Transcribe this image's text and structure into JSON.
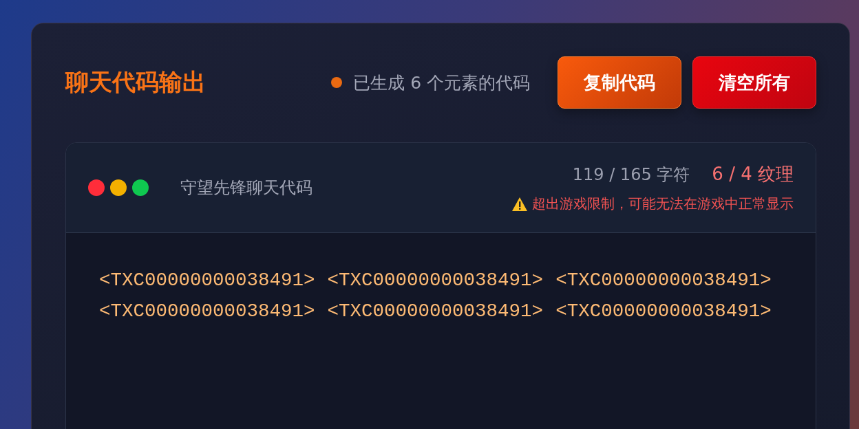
{
  "header": {
    "title": "聊天代码输出",
    "status": "已生成 6 个元素的代码",
    "buttons": [
      {
        "label": "复制代码",
        "kind": "copy"
      },
      {
        "label": "清空所有",
        "kind": "clear"
      }
    ]
  },
  "panel": {
    "title": "守望先锋聊天代码",
    "chars": "119 / 165 字符",
    "textures": "6 / 4 纹理",
    "over_limit": true,
    "warning": "超出游戏限制，可能无法在游戏中正常显示",
    "codes": [
      "<TXC00000000038491>",
      "<TXC00000000038491>",
      "<TXC00000000038491>",
      "<TXC00000000038491>",
      "<TXC00000000038491>",
      "<TXC00000000038491>"
    ]
  }
}
